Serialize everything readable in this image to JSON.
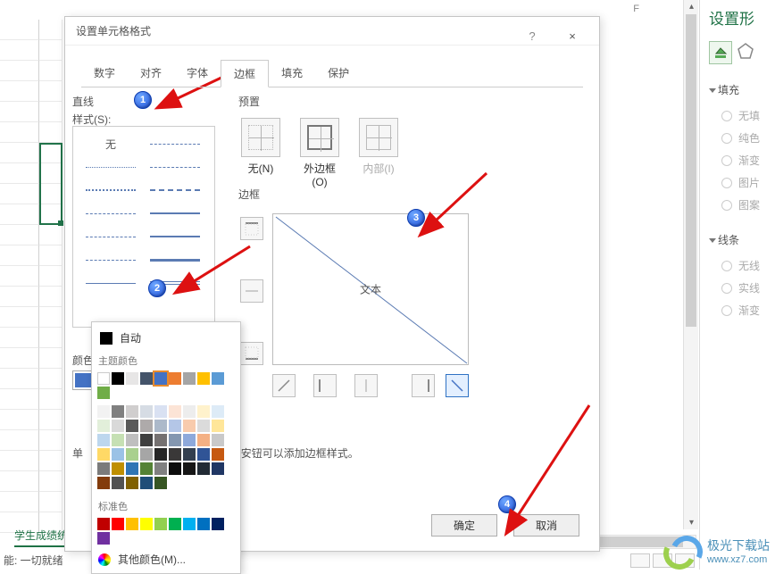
{
  "sheet": {
    "col_F": "F",
    "tab_name": "学生成绩统",
    "status": "能: 一切就绪"
  },
  "format_pane": {
    "title": "设置形",
    "fill_section": "填充",
    "fill_options": [
      "无填",
      "纯色",
      "渐变",
      "图片",
      "图案"
    ],
    "line_section": "线条",
    "line_options": [
      "无线",
      "实线",
      "渐变"
    ]
  },
  "dialog": {
    "title": "设置单元格格式",
    "help": "?",
    "close": "×",
    "tabs": [
      "数字",
      "对齐",
      "字体",
      "边框",
      "填充",
      "保护"
    ],
    "active_tab_index": 3,
    "line_header": "直线",
    "style_label": "样式(S):",
    "style_none": "无",
    "color_label": "颜色(C):",
    "selected_color": "#4472c4",
    "preset_header": "预置",
    "preset_none": "无(N)",
    "preset_outer": "外边框(O)",
    "preset_inner": "内部(I)",
    "border_header": "边框",
    "preview_text": "文本",
    "hint_prefix": "单",
    "hint_suffix": "安钮可以添加边框样式。",
    "ok": "确定",
    "cancel": "取消"
  },
  "color_popup": {
    "auto": "自动",
    "theme": "主题颜色",
    "theme_colors_row1": [
      "#ffffff",
      "#000000",
      "#e7e6e6",
      "#44546a",
      "#4472c4",
      "#ed7d31",
      "#a5a5a5",
      "#ffc000",
      "#5b9bd5",
      "#70ad47"
    ],
    "theme_tints": [
      [
        "#f2f2f2",
        "#808080",
        "#d0cece",
        "#d6dce4",
        "#d9e1f2",
        "#fce4d6",
        "#ededed",
        "#fff2cc",
        "#ddebf7",
        "#e2efda"
      ],
      [
        "#d9d9d9",
        "#595959",
        "#aeaaaa",
        "#acb9ca",
        "#b4c6e7",
        "#f8cbad",
        "#dbdbdb",
        "#ffe699",
        "#bdd7ee",
        "#c6e0b4"
      ],
      [
        "#bfbfbf",
        "#404040",
        "#757171",
        "#8497b0",
        "#8ea9db",
        "#f4b084",
        "#c9c9c9",
        "#ffd966",
        "#9bc2e6",
        "#a9d08e"
      ],
      [
        "#a6a6a6",
        "#262626",
        "#3a3838",
        "#333f4f",
        "#305496",
        "#c65911",
        "#7b7b7b",
        "#bf8f00",
        "#2f75b5",
        "#548235"
      ],
      [
        "#808080",
        "#0d0d0d",
        "#161616",
        "#222b35",
        "#203764",
        "#833c0c",
        "#525252",
        "#806000",
        "#1f4e78",
        "#375623"
      ]
    ],
    "standard": "标准色",
    "standard_colors": [
      "#c00000",
      "#ff0000",
      "#ffc000",
      "#ffff00",
      "#92d050",
      "#00b050",
      "#00b0f0",
      "#0070c0",
      "#002060",
      "#7030a0"
    ],
    "more": "其他颜色(M)..."
  },
  "badges": {
    "b1": "1",
    "b2": "2",
    "b3": "3",
    "b4": "4"
  },
  "watermark": {
    "brand": "极光下载站",
    "url": "www.xz7.com"
  }
}
